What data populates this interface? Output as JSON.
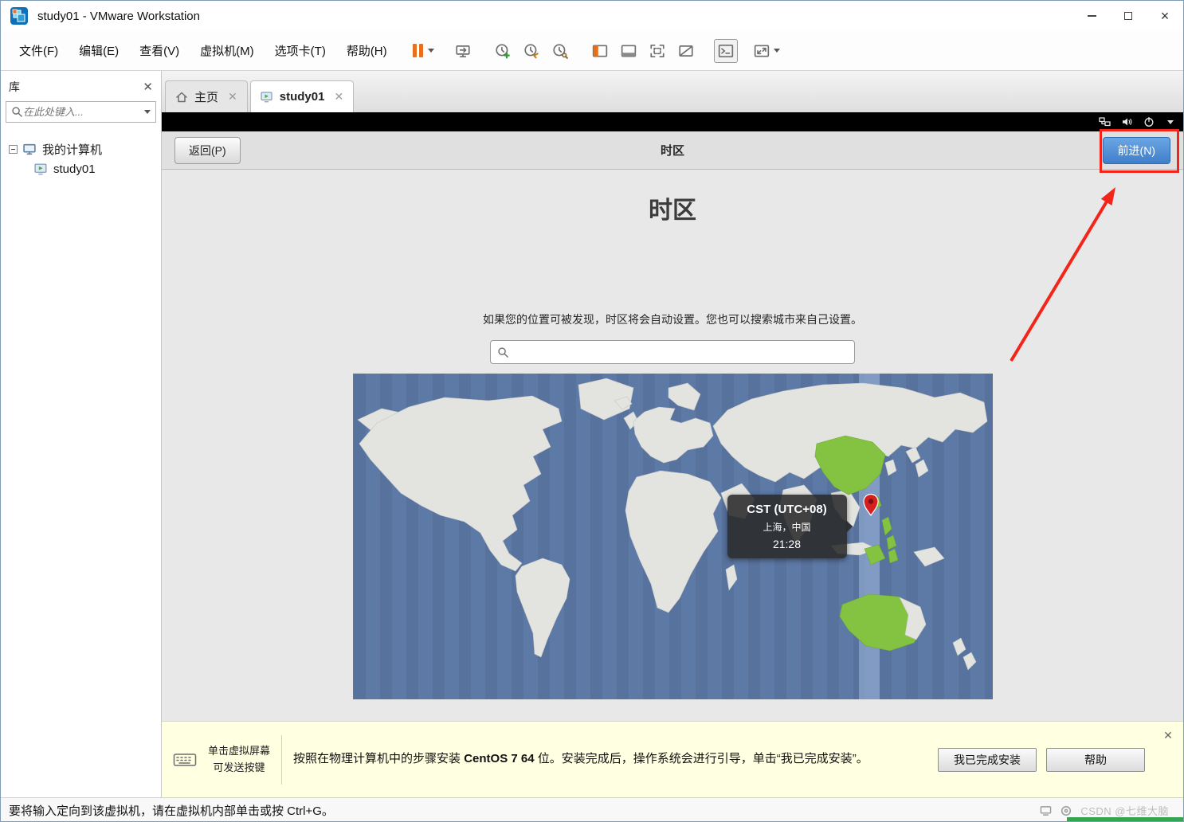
{
  "window": {
    "title": "study01 - VMware Workstation",
    "controls": [
      "minimize",
      "maximize",
      "close"
    ]
  },
  "menu": {
    "items": [
      "文件(F)",
      "编辑(E)",
      "查看(V)",
      "虚拟机(M)",
      "选项卡(T)",
      "帮助(H)"
    ]
  },
  "toolbar": {
    "icons": [
      "pause",
      "send-ctrl-alt-del",
      "take-snapshot",
      "revert-snapshot",
      "manage-snapshots",
      "show-library",
      "show-thumbnail-bar",
      "fit-guest",
      "autofit-guest",
      "console-view",
      "fullscreen"
    ]
  },
  "sidebar": {
    "title": "库",
    "search_placeholder": "在此处键入...",
    "tree": {
      "root": "我的计算机",
      "vm": "study01"
    }
  },
  "tabs": {
    "home": "主页",
    "vm": "study01"
  },
  "guest_topbar": {
    "icons": [
      "network",
      "volume",
      "power",
      "dropdown"
    ]
  },
  "installer": {
    "back": "返回(P)",
    "header_title": "时区",
    "forward": "前进(N)",
    "title": "时区",
    "instruction": "如果您的位置可被发现，时区将会自动设置。您也可以搜索城市来自己设置。",
    "search_value": "",
    "tooltip": {
      "timezone": "CST (UTC+08)",
      "city": "上海，中国",
      "time": "21:28"
    }
  },
  "hint": {
    "screen_line1": "单击虚拟屏幕",
    "screen_line2": "可发送按键",
    "message_pre": "按照在物理计算机中的步骤安装 ",
    "message_bold": "CentOS 7 64",
    "message_post": " 位。安装完成后，操作系统会进行引导，单击“我已完成安装”。",
    "done": "我已完成安装",
    "help": "帮助"
  },
  "status": {
    "message": "要将输入定向到该虚拟机，请在虚拟机内部单击或按 Ctrl+G。",
    "watermark": "CSDN @七维大脑"
  },
  "colors": {
    "accent_orange": "#e8701a",
    "suggested_blue": "#4a90d9",
    "annotation_red": "#f3251a",
    "map_ocean": "#5d79a6",
    "map_land": "#e3e3e0",
    "map_selected_green": "#84c341"
  }
}
